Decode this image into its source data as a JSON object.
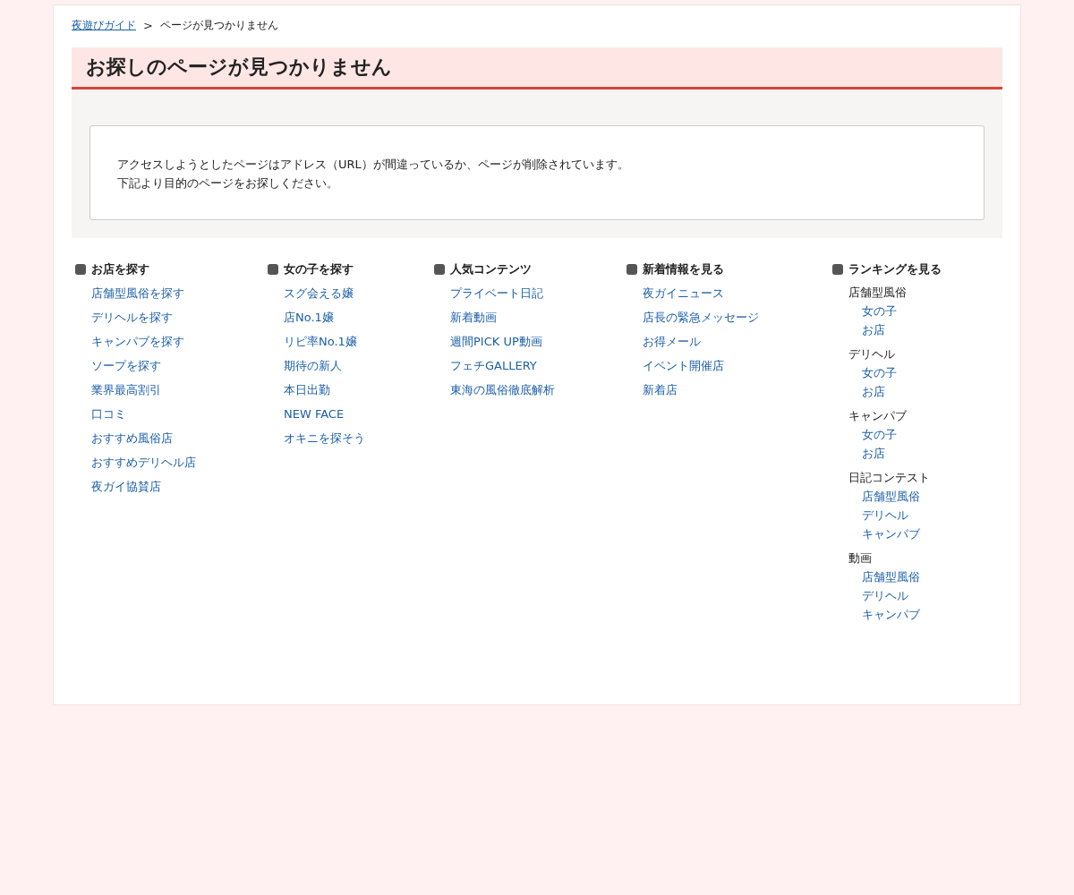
{
  "breadcrumb": {
    "link": "夜遊びガイド",
    "separator": ">",
    "current": "ページが見つかりません"
  },
  "heading": "お探しのページが見つかりません",
  "message": [
    "アクセスしようとしたページはアドレス（URL）が間違っているか、ページが削除されています。",
    "下記より目的のページをお探しください。"
  ],
  "sitemap": [
    {
      "kind": "links",
      "heading": "お店を探す",
      "links": [
        "店舗型風俗を探す",
        "デリヘルを探す",
        "キャンパブを探す",
        "ソープを探す",
        "業界最高割引",
        "口コミ",
        "おすすめ風俗店",
        "おすすめデリヘル店",
        "夜ガイ協賛店"
      ]
    },
    {
      "kind": "links",
      "heading": "女の子を探す",
      "links": [
        "スグ会える嬢",
        "店No.1嬢",
        "リピ率No.1嬢",
        "期待の新人",
        "本日出勤",
        "NEW FACE",
        "オキニを探そう"
      ]
    },
    {
      "kind": "links",
      "heading": "人気コンテンツ",
      "links": [
        "プライベート日記",
        "新着動画",
        "週間PICK UP動画",
        "フェチGALLERY",
        "東海の風俗徹底解析"
      ]
    },
    {
      "kind": "links",
      "heading": "新着情報を見る",
      "links": [
        "夜ガイニュース",
        "店長の緊急メッセージ",
        "お得メール",
        "イベント開催店",
        "新着店"
      ]
    },
    {
      "kind": "groups",
      "heading": "ランキングを見る",
      "groups": [
        {
          "label": "店舗型風俗",
          "links": [
            "女の子",
            "お店"
          ]
        },
        {
          "label": "デリヘル",
          "links": [
            "女の子",
            "お店"
          ]
        },
        {
          "label": "キャンパブ",
          "links": [
            "女の子",
            "お店"
          ]
        },
        {
          "label": "日記コンテスト",
          "links": [
            "店舗型風俗",
            "デリヘル",
            "キャンパブ"
          ]
        },
        {
          "label": "動画",
          "links": [
            "店舗型風俗",
            "デリヘル",
            "キャンパブ"
          ]
        }
      ]
    }
  ]
}
